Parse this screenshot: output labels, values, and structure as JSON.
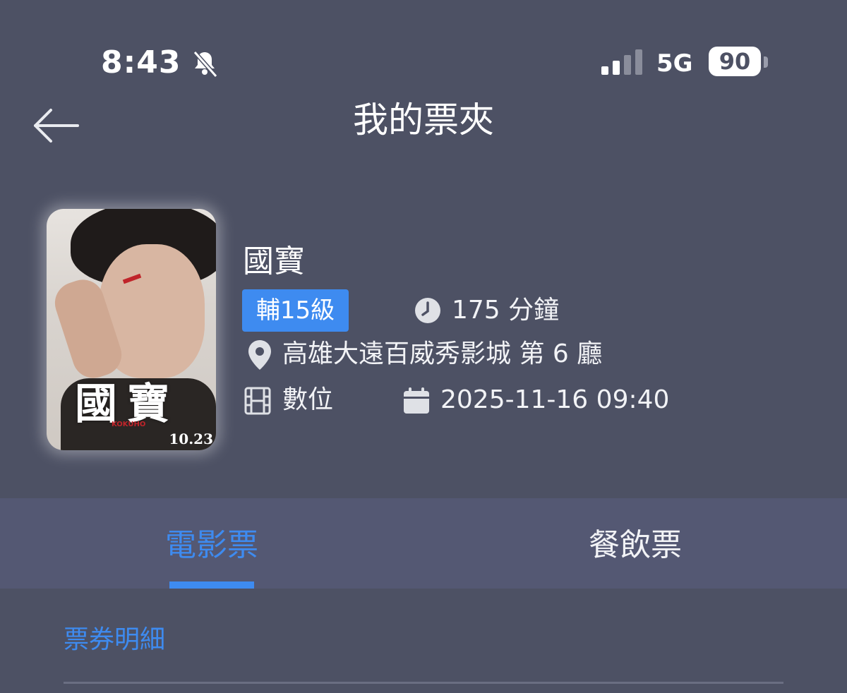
{
  "status_bar": {
    "time": "8:43",
    "network": "5G",
    "battery": "90",
    "icons": [
      "bell-slash-icon",
      "signal-icon",
      "battery-icon"
    ]
  },
  "header": {
    "title": "我的票夾",
    "back_icon": "arrow-left-icon"
  },
  "movie": {
    "poster": {
      "title_text": "國寶",
      "english_text": "KOKUHO",
      "date_text": "10.23"
    },
    "title": "國寶",
    "rating": "輔15級",
    "duration": "175 分鐘",
    "cinema": "高雄大遠百威秀影城 第 6 廳",
    "format": "數位",
    "datetime": "2025-11-16 09:40"
  },
  "tabs": [
    {
      "label": "電影票",
      "active": true
    },
    {
      "label": "餐飲票",
      "active": false
    }
  ],
  "section": {
    "title": "票券明細"
  },
  "colors": {
    "background": "#4d5164",
    "tab_bar": "#545873",
    "accent": "#3e8bf0"
  }
}
